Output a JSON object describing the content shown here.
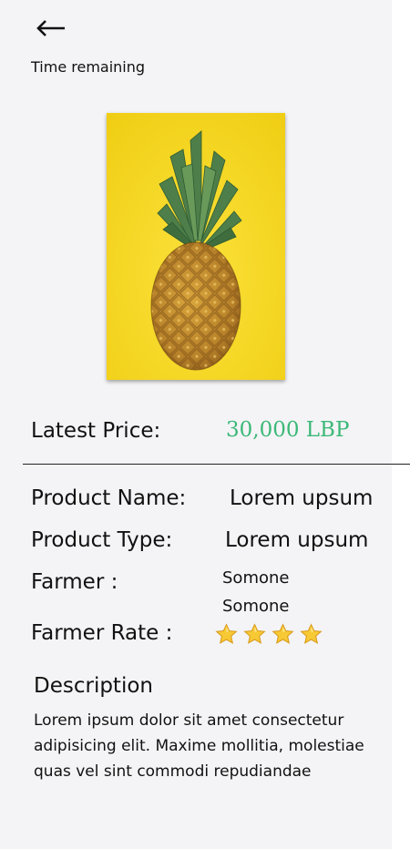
{
  "header": {
    "back_icon": "arrow-left-icon",
    "time_remaining_label": "Time remaining"
  },
  "product": {
    "image_subject": "pineapple on yellow background",
    "latest_price_label": "Latest Price:",
    "latest_price_value": "30,000 LBP",
    "price_color": "#3cb878",
    "name_label": "Product Name:",
    "name_value": "Lorem upsum",
    "type_label": "Product Type:",
    "type_value": "Lorem upsum",
    "farmer_label": "Farmer :",
    "farmer_first_name": "Somone",
    "farmer_last_name": "Somone",
    "farmer_rate_label": "Farmer Rate :",
    "farmer_rating": 4,
    "farmer_rating_max": 4,
    "star_icon": "star-icon"
  },
  "description": {
    "title": "Description",
    "body": "Lorem ipsum dolor sit amet consectetur adipisicing elit. Maxime mollitia, molestiae quas vel sint commodi repudiandae"
  },
  "colors": {
    "panel_background": "#f4f4f6",
    "price_green": "#3cb878",
    "image_background": "#f2d21c"
  }
}
